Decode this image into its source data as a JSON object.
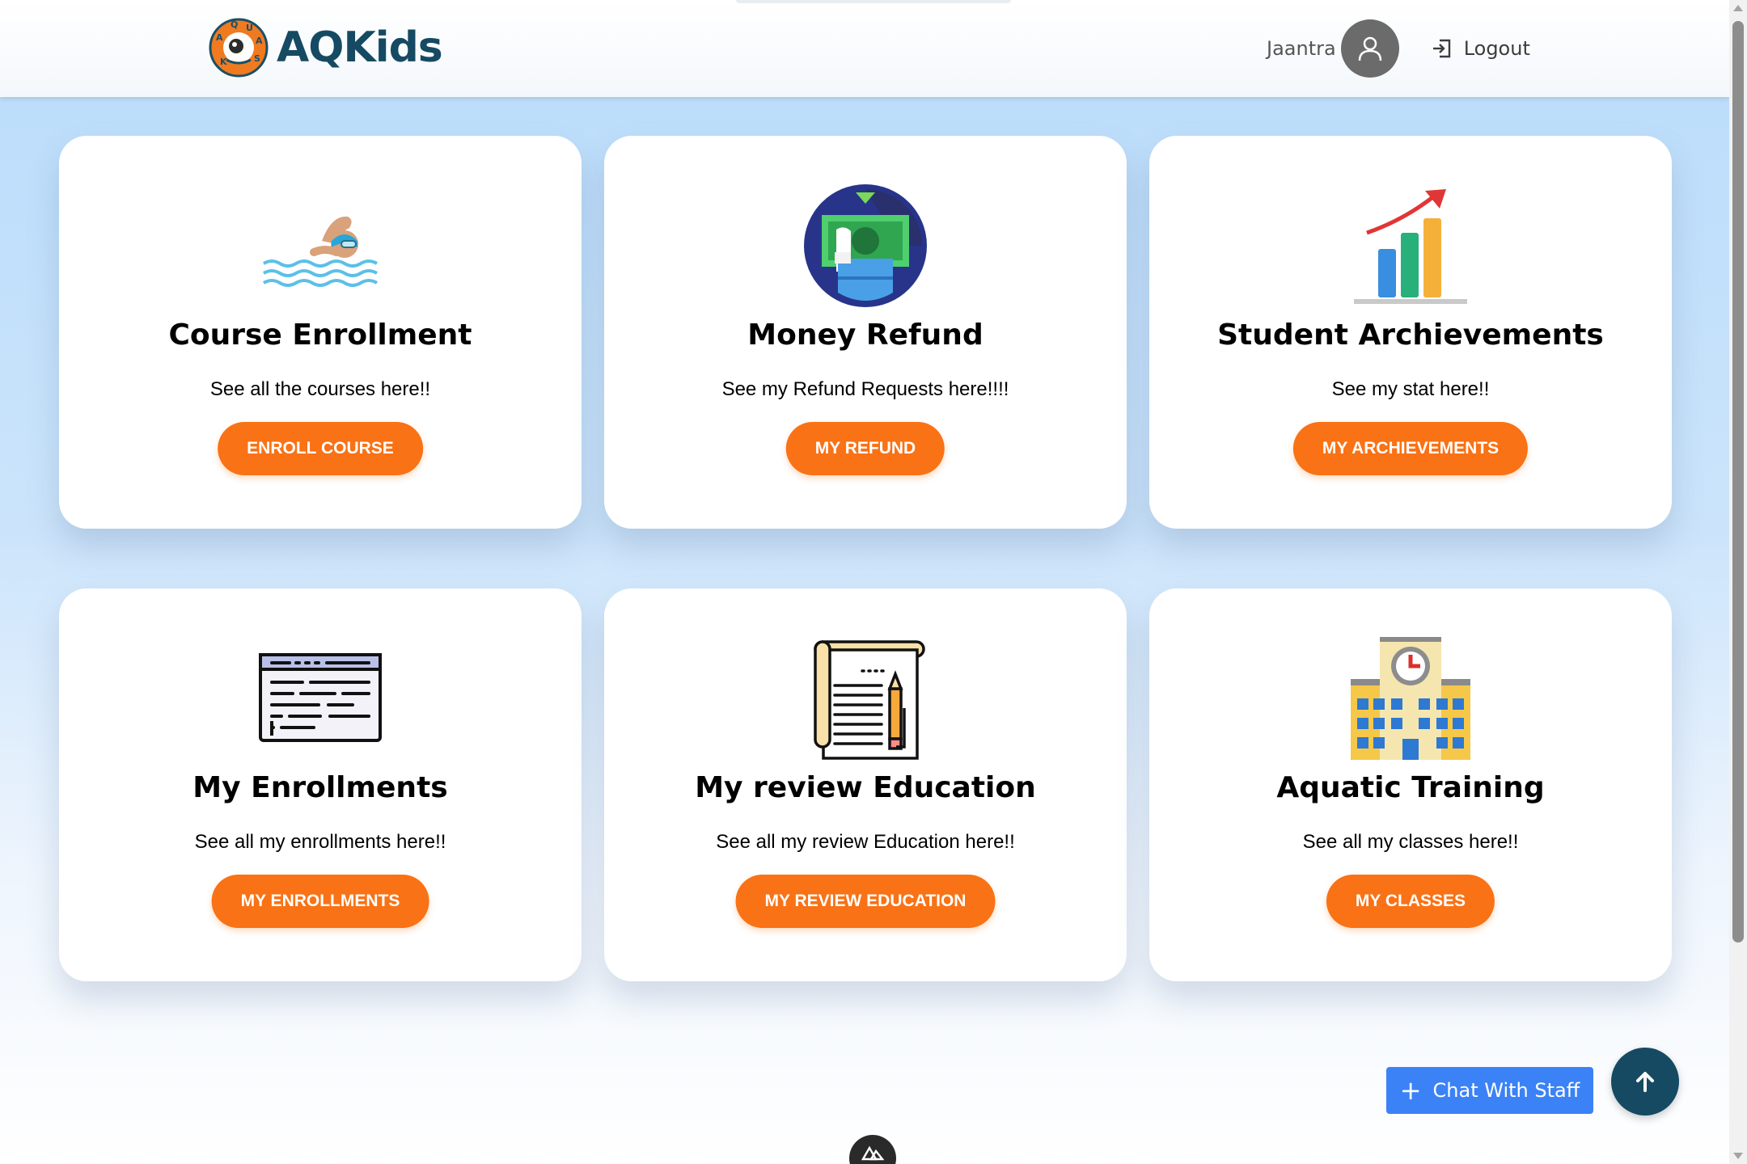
{
  "header": {
    "brand": "AQKids",
    "user_name": "Jaantra",
    "logout_label": "Logout"
  },
  "cards": [
    {
      "title": "Course Enrollment",
      "desc": "See all the courses here!!",
      "button": "ENROLL COURSE",
      "icon": "swimmer-icon"
    },
    {
      "title": "Money Refund",
      "desc": "See my Refund Requests here!!!!",
      "button": "MY REFUND",
      "icon": "money-refund-icon"
    },
    {
      "title": "Student Archievements",
      "desc": "See my stat here!!",
      "button": "MY ARCHIEVEMENTS",
      "icon": "growth-chart-icon"
    },
    {
      "title": "My Enrollments",
      "desc": "See all my enrollments here!!",
      "button": "MY ENROLLMENTS",
      "icon": "document-list-icon"
    },
    {
      "title": "My review Education",
      "desc": "See all my review Education here!!",
      "button": "MY REVIEW EDUCATION",
      "icon": "notepad-pencil-icon"
    },
    {
      "title": "Aquatic Training",
      "desc": "See all my classes here!!",
      "button": "MY CLASSES",
      "icon": "school-building-icon"
    }
  ],
  "chat": {
    "label": "Chat With Staff"
  },
  "colors": {
    "accent_orange": "#f97215",
    "brand_teal": "#164a63",
    "chat_blue": "#3b82f6"
  }
}
